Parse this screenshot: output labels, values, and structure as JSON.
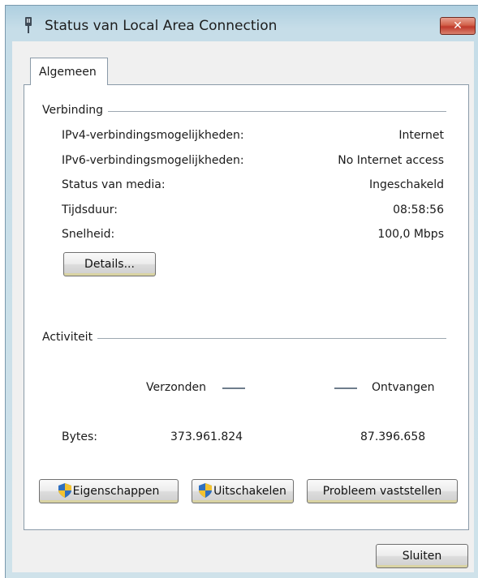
{
  "window": {
    "title": "Status van Local Area Connection",
    "close_label": "✕"
  },
  "tabs": [
    {
      "label": "Algemeen"
    }
  ],
  "connection": {
    "group_label": "Verbinding",
    "rows": [
      {
        "label": "IPv4-verbindingsmogelijkheden:",
        "value": "Internet"
      },
      {
        "label": "IPv6-verbindingsmogelijkheden:",
        "value": "No Internet access"
      },
      {
        "label": "Status van media:",
        "value": "Ingeschakeld"
      },
      {
        "label": "Tijdsduur:",
        "value": "08:58:56"
      },
      {
        "label": "Snelheid:",
        "value": "100,0 Mbps"
      }
    ],
    "details_button": "Details..."
  },
  "activity": {
    "group_label": "Activiteit",
    "sent_label": "Verzonden",
    "received_label": "Ontvangen",
    "bytes_label": "Bytes:",
    "bytes_sent": "373.961.824",
    "bytes_received": "87.396.658"
  },
  "actions": {
    "properties_button": "Eigenschappen",
    "disable_button": "Uitschakelen",
    "diagnose_button": "Probleem vaststellen"
  },
  "footer": {
    "close_button": "Sluiten"
  },
  "colors": {
    "title_gradient": "#aecfe0",
    "close_button_red": "#c0392b",
    "dialog_background": "#f0f0f0"
  }
}
